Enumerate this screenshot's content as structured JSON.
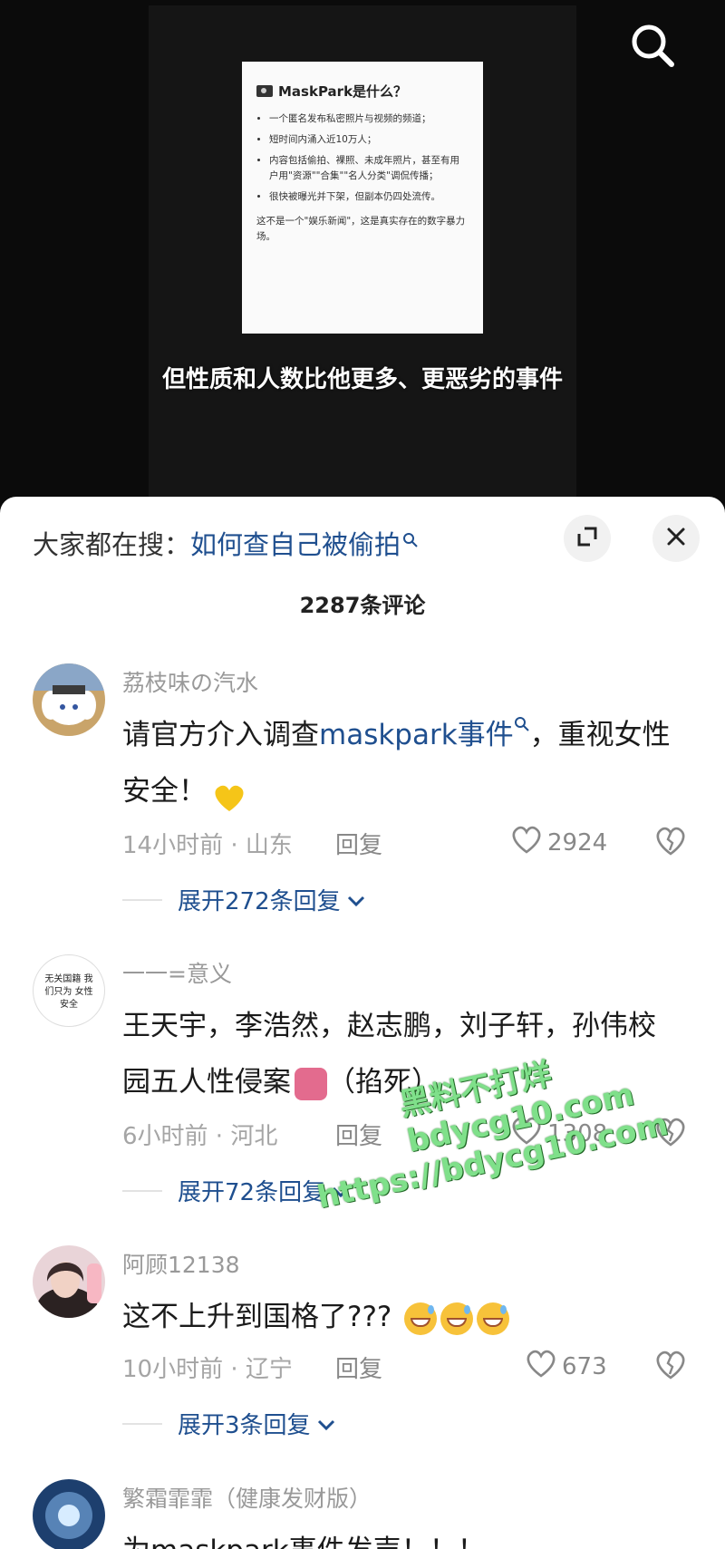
{
  "video": {
    "doc_card": {
      "title": "MaskPark是什么？",
      "bullets": [
        "一个匿名发布私密照片与视频的频道；",
        "短时间内涌入近10万人；",
        "内容包括偷拍、裸照、未成年照片，甚至有用户用\"资源\"\"合集\"\"名人分类\"调侃传播；",
        "很快被曝光并下架，但副本仍四处流传。"
      ],
      "footer": "这不是一个\"娱乐新闻\"，这是真实存在的数字暴力场。"
    },
    "subtitle": "但性质和人数比他更多、更恶劣的事件"
  },
  "sheet": {
    "search_hint_prefix": "大家都在搜：",
    "search_hint_keyword": "如何查自己被偷拍",
    "comment_count": "2287条评论"
  },
  "comments": [
    {
      "username": "荔枝味の汽水",
      "text_before": "请官方介入调查",
      "text_link": "maskpark事件",
      "text_after": "，重视女性安全！",
      "time_location": "14小时前 · 山东",
      "reply_label": "回复",
      "likes": "2924",
      "expand_label": "展开272条回复"
    },
    {
      "username": "一一=意义",
      "avatar_text": "无关国籍 我们只为 女性安全",
      "text_before": "王天宇，李浩然，赵志鹏，刘子轩，孙伟校园五人性侵案",
      "text_after": "（掐死）",
      "time_location": "6小时前 · 河北",
      "reply_label": "回复",
      "likes": "1308",
      "expand_label": "展开72条回复"
    },
    {
      "username": "阿顾12138",
      "text_before": "这不上升到国格了???",
      "time_location": "10小时前 · 辽宁",
      "reply_label": "回复",
      "likes": "673",
      "expand_label": "展开3条回复"
    },
    {
      "username": "繁霜霏霏（健康发财版）",
      "text_before": "为maskpark事件发声！！！"
    }
  ],
  "watermark": {
    "line1": "黑料不打烊",
    "line2": "bdycg10.com",
    "line3": "https://bdycg10.com"
  },
  "colors": {
    "link": "#1f4f8f",
    "meta": "#a5a5a5",
    "watermark": "#7fe08a"
  }
}
